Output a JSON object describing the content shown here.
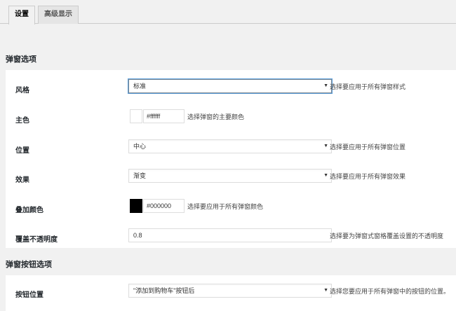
{
  "tabs": [
    {
      "label": "设置",
      "active": true
    },
    {
      "label": "高级显示",
      "active": false
    }
  ],
  "popup_section": {
    "title": "弹窗选项",
    "rows": [
      {
        "label": "风格",
        "value": "标准",
        "desc": "选择要应用于所有弹窗样式"
      },
      {
        "label": "主色",
        "value": "#ffffff",
        "swatch": "#ffffff",
        "desc": "选择弹窗的主要颜色"
      },
      {
        "label": "位置",
        "value": "中心",
        "desc": "选择要应用于所有弹窗位置"
      },
      {
        "label": "效果",
        "value": "渐变",
        "desc": "选择要应用于所有弹窗效果"
      },
      {
        "label": "叠加颜色",
        "value": "#000000",
        "swatch": "#000000",
        "desc": "选择要应用于所有弹窗颜色"
      },
      {
        "label": "覆盖不透明度",
        "value": "0.8",
        "desc": "选择要为弹窗式窗格覆盖设置的不透明度"
      }
    ]
  },
  "button_section": {
    "title": "弹窗按钮选项",
    "rows": [
      {
        "label": "按钮位置",
        "value": "\"添加到购物车\"按钮后",
        "desc": "选择您要应用于所有弹窗中的按钮的位置。"
      }
    ]
  },
  "icons": {
    "dropdown": "chevron-down-icon"
  }
}
